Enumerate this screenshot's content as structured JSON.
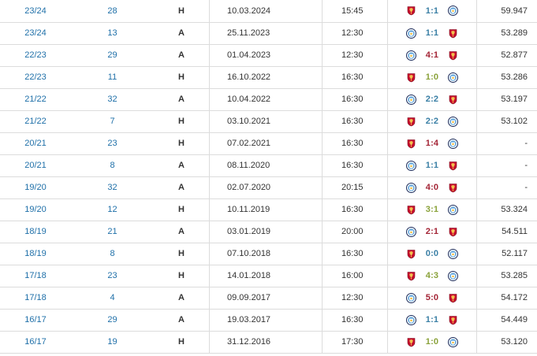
{
  "colors": {
    "link": "#1e6fa8",
    "draw": "#3a7fa5",
    "win": "#8aa23a",
    "loss": "#a32435",
    "liverpool": "#c8102e",
    "man_city": "#6cabdd"
  },
  "icons": {
    "liverpool": "liverpool-crest-icon",
    "man_city": "man-city-crest-icon"
  },
  "matches": [
    {
      "season": "23/24",
      "round": "28",
      "venue": "H",
      "date": "10.03.2024",
      "time": "15:45",
      "home": "liverpool",
      "away": "man_city",
      "score": "1:1",
      "result": "draw",
      "attendance": "59.947"
    },
    {
      "season": "23/24",
      "round": "13",
      "venue": "A",
      "date": "25.11.2023",
      "time": "12:30",
      "home": "man_city",
      "away": "liverpool",
      "score": "1:1",
      "result": "draw",
      "attendance": "53.289"
    },
    {
      "season": "22/23",
      "round": "29",
      "venue": "A",
      "date": "01.04.2023",
      "time": "12:30",
      "home": "man_city",
      "away": "liverpool",
      "score": "4:1",
      "result": "loss",
      "attendance": "52.877"
    },
    {
      "season": "22/23",
      "round": "11",
      "venue": "H",
      "date": "16.10.2022",
      "time": "16:30",
      "home": "liverpool",
      "away": "man_city",
      "score": "1:0",
      "result": "win",
      "attendance": "53.286"
    },
    {
      "season": "21/22",
      "round": "32",
      "venue": "A",
      "date": "10.04.2022",
      "time": "16:30",
      "home": "man_city",
      "away": "liverpool",
      "score": "2:2",
      "result": "draw",
      "attendance": "53.197"
    },
    {
      "season": "21/22",
      "round": "7",
      "venue": "H",
      "date": "03.10.2021",
      "time": "16:30",
      "home": "liverpool",
      "away": "man_city",
      "score": "2:2",
      "result": "draw",
      "attendance": "53.102"
    },
    {
      "season": "20/21",
      "round": "23",
      "venue": "H",
      "date": "07.02.2021",
      "time": "16:30",
      "home": "liverpool",
      "away": "man_city",
      "score": "1:4",
      "result": "loss",
      "attendance": "-"
    },
    {
      "season": "20/21",
      "round": "8",
      "venue": "A",
      "date": "08.11.2020",
      "time": "16:30",
      "home": "man_city",
      "away": "liverpool",
      "score": "1:1",
      "result": "draw",
      "attendance": "-"
    },
    {
      "season": "19/20",
      "round": "32",
      "venue": "A",
      "date": "02.07.2020",
      "time": "20:15",
      "home": "man_city",
      "away": "liverpool",
      "score": "4:0",
      "result": "loss",
      "attendance": "-"
    },
    {
      "season": "19/20",
      "round": "12",
      "venue": "H",
      "date": "10.11.2019",
      "time": "16:30",
      "home": "liverpool",
      "away": "man_city",
      "score": "3:1",
      "result": "win",
      "attendance": "53.324"
    },
    {
      "season": "18/19",
      "round": "21",
      "venue": "A",
      "date": "03.01.2019",
      "time": "20:00",
      "home": "man_city",
      "away": "liverpool",
      "score": "2:1",
      "result": "loss",
      "attendance": "54.511"
    },
    {
      "season": "18/19",
      "round": "8",
      "venue": "H",
      "date": "07.10.2018",
      "time": "16:30",
      "home": "liverpool",
      "away": "man_city",
      "score": "0:0",
      "result": "draw",
      "attendance": "52.117"
    },
    {
      "season": "17/18",
      "round": "23",
      "venue": "H",
      "date": "14.01.2018",
      "time": "16:00",
      "home": "liverpool",
      "away": "man_city",
      "score": "4:3",
      "result": "win",
      "attendance": "53.285"
    },
    {
      "season": "17/18",
      "round": "4",
      "venue": "A",
      "date": "09.09.2017",
      "time": "12:30",
      "home": "man_city",
      "away": "liverpool",
      "score": "5:0",
      "result": "loss",
      "attendance": "54.172"
    },
    {
      "season": "16/17",
      "round": "29",
      "venue": "A",
      "date": "19.03.2017",
      "time": "16:30",
      "home": "man_city",
      "away": "liverpool",
      "score": "1:1",
      "result": "draw",
      "attendance": "54.449"
    },
    {
      "season": "16/17",
      "round": "19",
      "venue": "H",
      "date": "31.12.2016",
      "time": "17:30",
      "home": "liverpool",
      "away": "man_city",
      "score": "1:0",
      "result": "win",
      "attendance": "53.120"
    }
  ]
}
